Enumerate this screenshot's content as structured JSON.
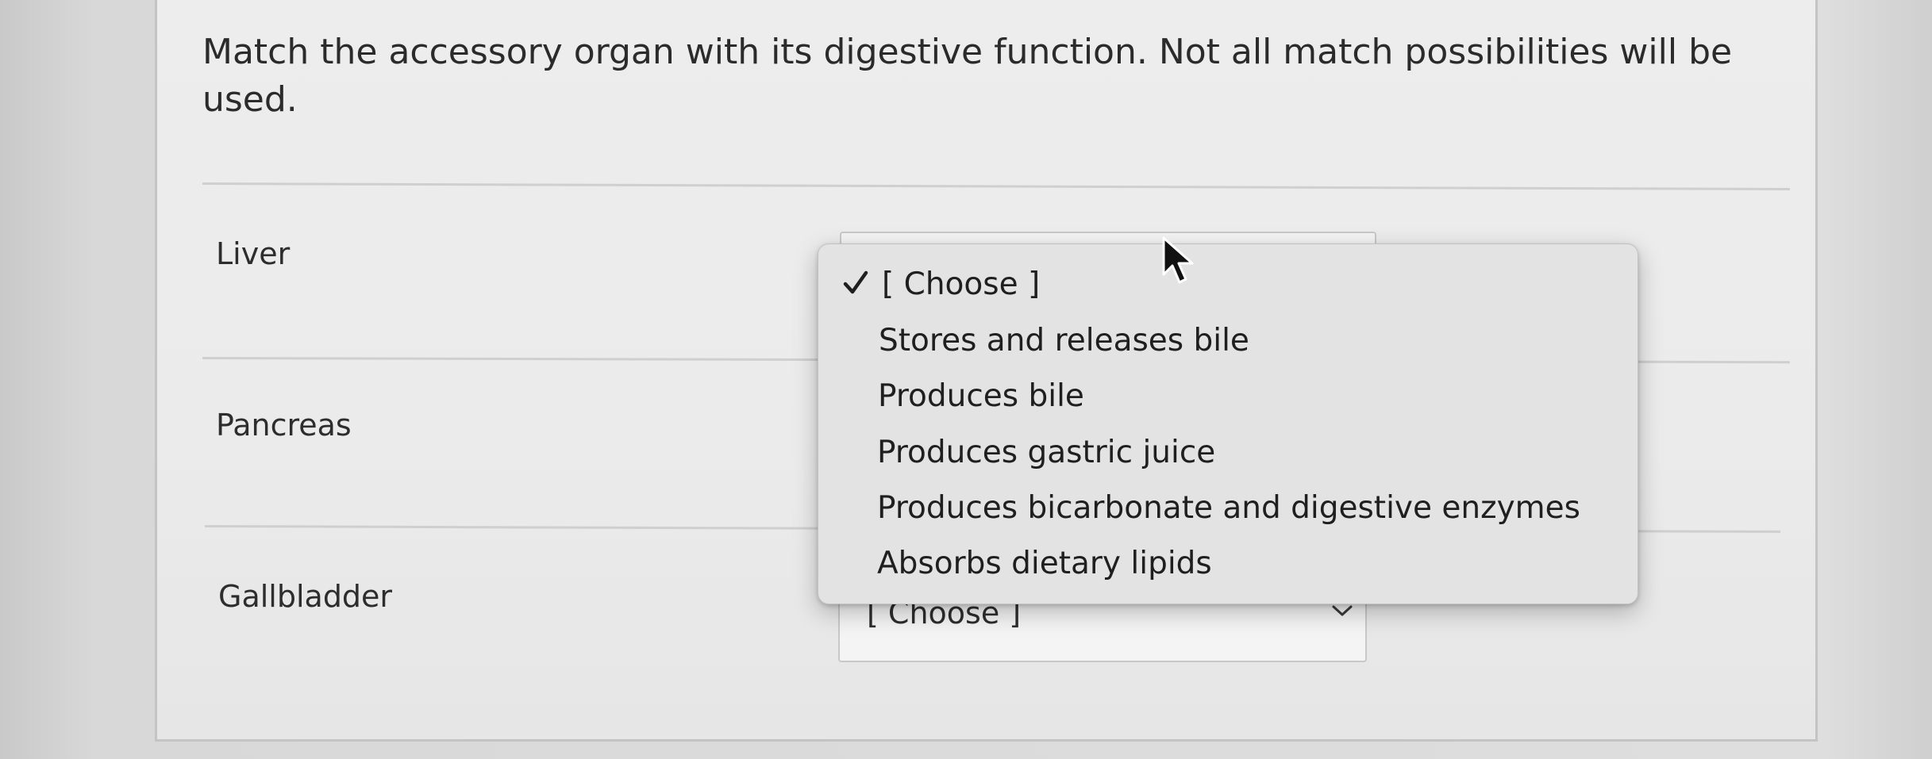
{
  "question": {
    "line1": "Match the accessory organ with its digestive function. Not all match possibilities will be",
    "line2": "used."
  },
  "rows": [
    {
      "label": "Liver"
    },
    {
      "label": "Pancreas"
    },
    {
      "label": "Gallbladder",
      "select_value": "[ Choose ]"
    }
  ],
  "dropdown": {
    "options": [
      {
        "label": "[ Choose ]",
        "selected": true
      },
      {
        "label": "Stores and releases bile"
      },
      {
        "label": "Produces bile"
      },
      {
        "label": "Produces gastric juice"
      },
      {
        "label": "Produces bicarbonate and digestive enzymes"
      },
      {
        "label": "Absorbs dietary lipids"
      }
    ]
  },
  "icons": {
    "checkmark": "checkmark-icon",
    "chevron": "chevron-down-icon",
    "cursor": "mouse-pointer-icon"
  }
}
